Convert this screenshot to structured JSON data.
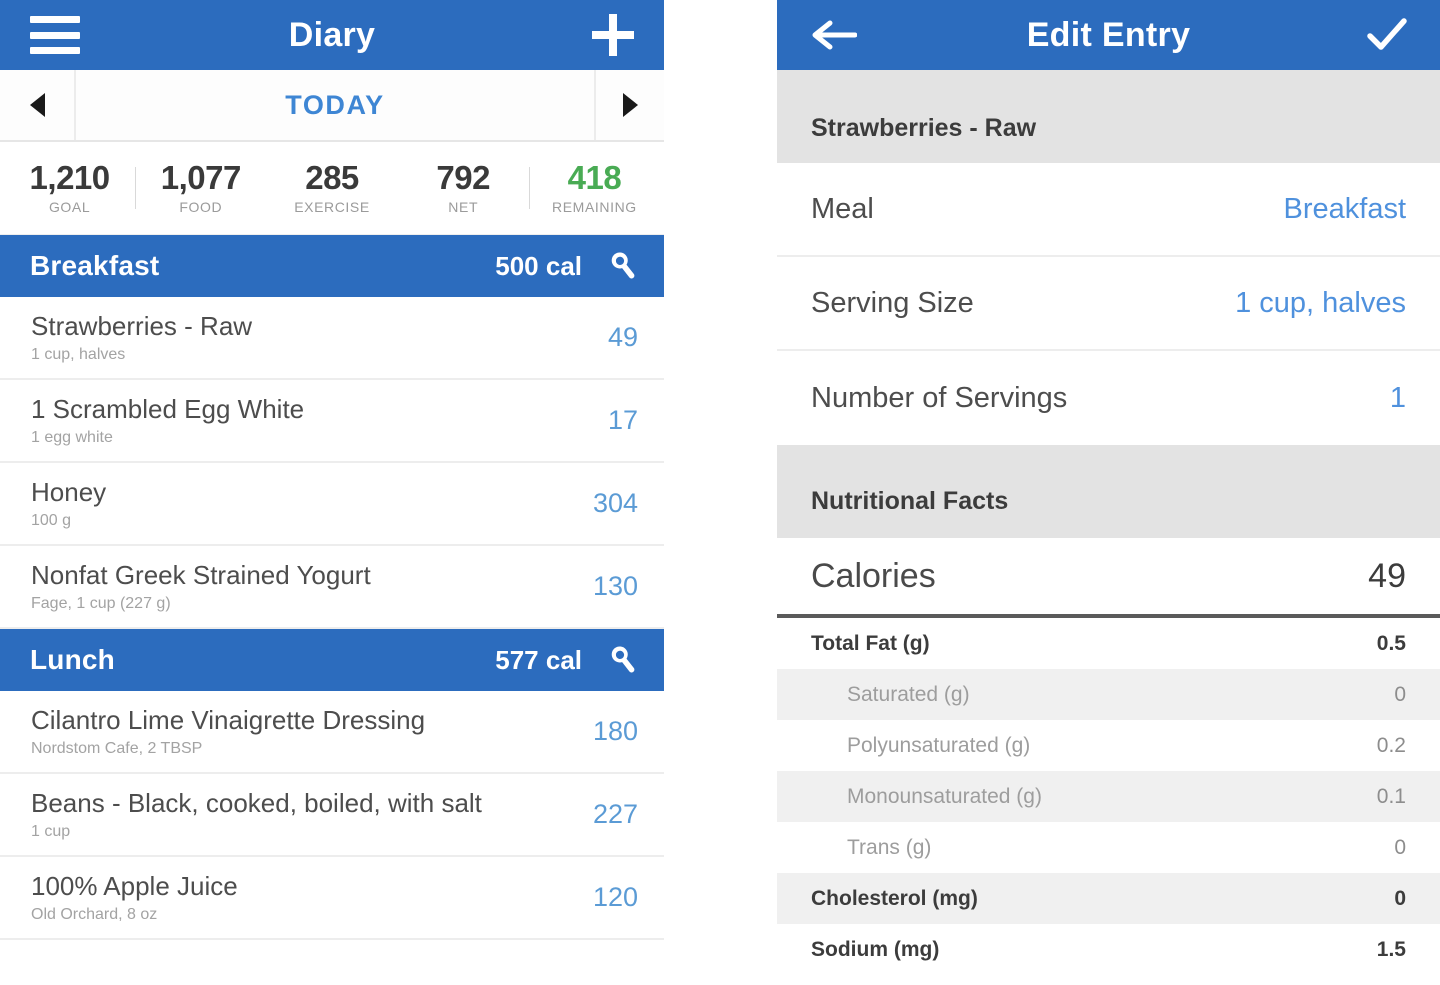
{
  "colors": {
    "brand_blue": "#2c6cbe",
    "link_blue": "#5b9bd5",
    "accent_blue": "#4f91dd",
    "remaining_green": "#49ab54",
    "band_gray": "#e3e3e3"
  },
  "diary": {
    "nav": {
      "title": "Diary",
      "menu_icon": "hamburger-icon",
      "add_icon": "plus-icon"
    },
    "date_nav": {
      "prev_icon": "triangle-left-icon",
      "label": "TODAY",
      "next_icon": "triangle-right-icon"
    },
    "summary": [
      {
        "value": "1,210",
        "label": "GOAL",
        "accent": false
      },
      {
        "value": "1,077",
        "label": "FOOD",
        "accent": false
      },
      {
        "value": "285",
        "label": "EXERCISE",
        "accent": false
      },
      {
        "value": "792",
        "label": "NET",
        "accent": false
      },
      {
        "value": "418",
        "label": "REMAINING",
        "accent": true
      }
    ],
    "meals": [
      {
        "name": "Breakfast",
        "calories": "500 cal",
        "tool_icon": "wrench-icon",
        "items": [
          {
            "name": "Strawberries - Raw",
            "detail": "1 cup, halves",
            "calories": "49"
          },
          {
            "name": "1 Scrambled Egg White",
            "detail": "1 egg white",
            "calories": "17"
          },
          {
            "name": "Honey",
            "detail": "100 g",
            "calories": "304"
          },
          {
            "name": "Nonfat Greek Strained Yogurt",
            "detail": "Fage, 1 cup (227 g)",
            "calories": "130"
          }
        ]
      },
      {
        "name": "Lunch",
        "calories": "577 cal",
        "tool_icon": "wrench-icon",
        "items": [
          {
            "name": "Cilantro Lime Vinaigrette Dressing",
            "detail": "Nordstom Cafe, 2 TBSP",
            "calories": "180"
          },
          {
            "name": "Beans - Black, cooked, boiled, with salt",
            "detail": "1 cup",
            "calories": "227"
          },
          {
            "name": "100% Apple Juice",
            "detail": "Old Orchard, 8 oz",
            "calories": "120"
          }
        ]
      }
    ]
  },
  "edit_entry": {
    "nav": {
      "title": "Edit Entry",
      "back_icon": "arrow-left-icon",
      "confirm_icon": "check-icon"
    },
    "food_title": "Strawberries - Raw",
    "fields": [
      {
        "label": "Meal",
        "value": "Breakfast"
      },
      {
        "label": "Serving Size",
        "value": "1 cup, halves"
      },
      {
        "label": "Number of Servings",
        "value": "1"
      }
    ],
    "facts_heading": "Nutritional Facts",
    "calories": {
      "label": "Calories",
      "value": "49"
    },
    "nutrients": [
      {
        "label": "Total Fat (g)",
        "value": "0.5",
        "bold": true,
        "indent": false
      },
      {
        "label": "Saturated (g)",
        "value": "0",
        "bold": false,
        "indent": true
      },
      {
        "label": "Polyunsaturated (g)",
        "value": "0.2",
        "bold": false,
        "indent": true
      },
      {
        "label": "Monounsaturated (g)",
        "value": "0.1",
        "bold": false,
        "indent": true
      },
      {
        "label": "Trans (g)",
        "value": "0",
        "bold": false,
        "indent": true
      },
      {
        "label": "Cholesterol (mg)",
        "value": "0",
        "bold": true,
        "indent": false
      },
      {
        "label": "Sodium (mg)",
        "value": "1.5",
        "bold": true,
        "indent": false
      }
    ]
  }
}
